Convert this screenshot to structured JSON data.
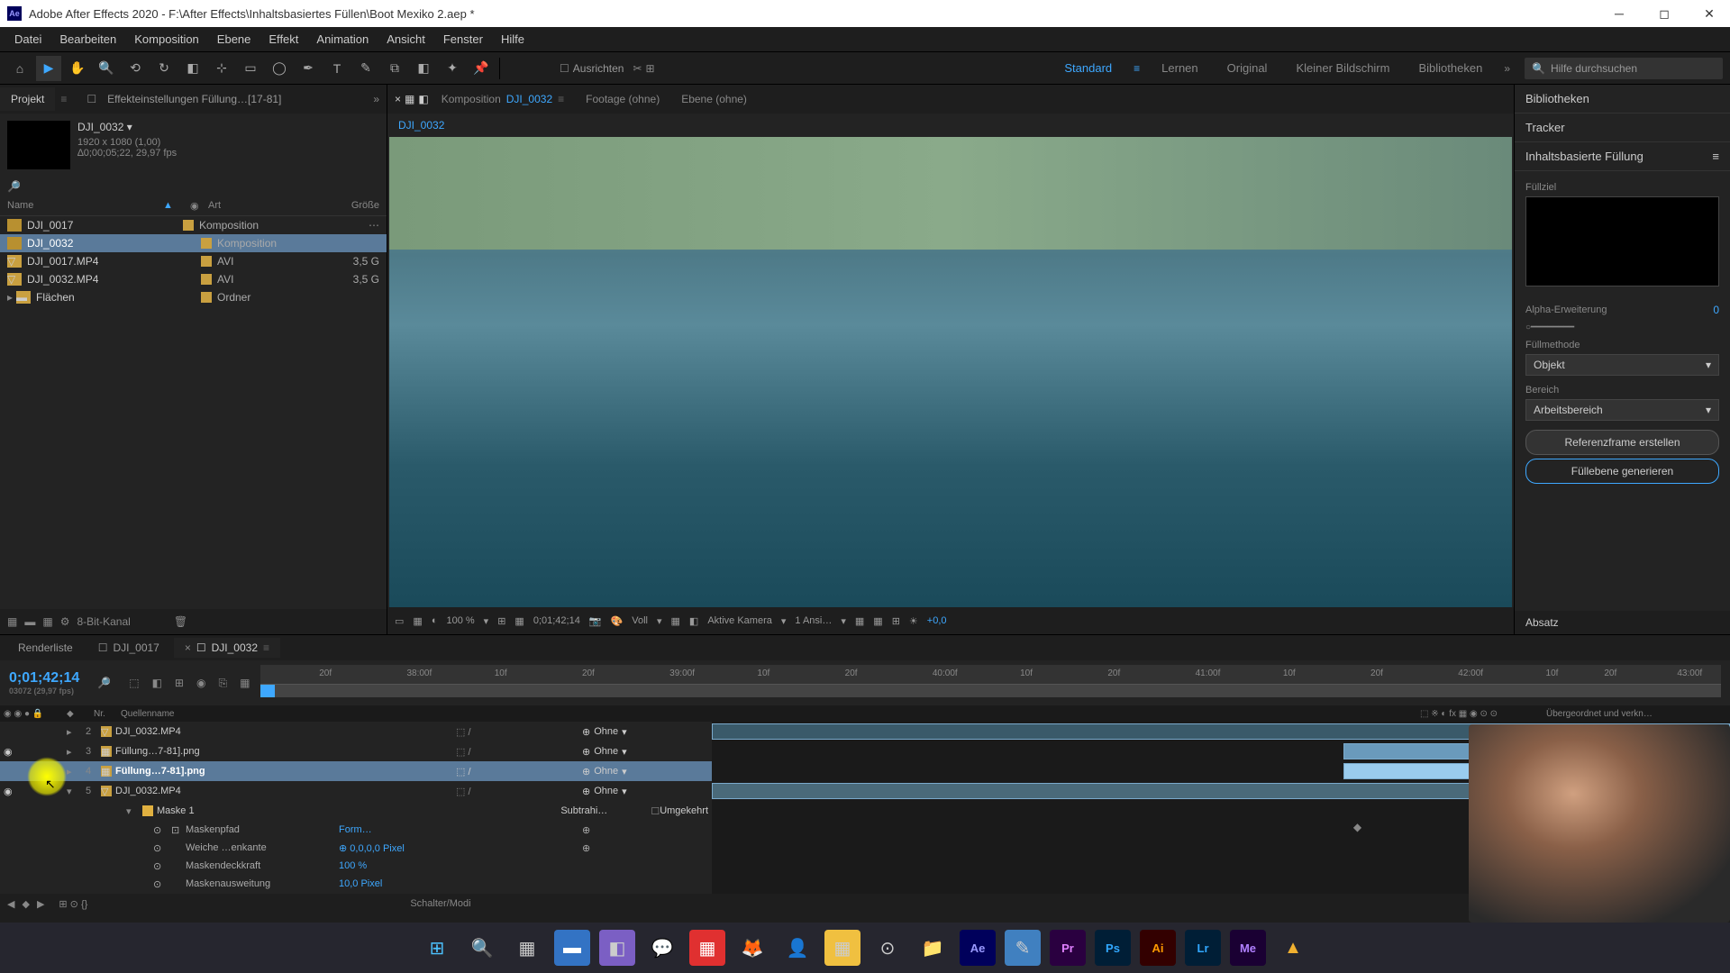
{
  "titlebar": {
    "app_icon": "Ae",
    "title": "Adobe After Effects 2020 - F:\\After Effects\\Inhaltsbasiertes Füllen\\Boot Mexiko 2.aep *"
  },
  "menubar": {
    "items": [
      "Datei",
      "Bearbeiten",
      "Komposition",
      "Ebene",
      "Effekt",
      "Animation",
      "Ansicht",
      "Fenster",
      "Hilfe"
    ]
  },
  "toolbar": {
    "ausrichten": "Ausrichten",
    "workspaces": [
      "Standard",
      "Lernen",
      "Original",
      "Kleiner Bildschirm",
      "Bibliotheken"
    ],
    "search_placeholder": "Hilfe durchsuchen"
  },
  "project": {
    "tab_project": "Projekt",
    "tab_effect": "Effekteinstellungen  Füllung…[17-81]",
    "comp_name": "DJI_0032 ▾",
    "comp_res": "1920 x 1080 (1,00)",
    "comp_dur": "∆0;00;05;22, 29,97 fps",
    "cols": {
      "name": "Name",
      "art": "Art",
      "size": "Größe"
    },
    "items": [
      {
        "name": "DJI_0017",
        "art": "Komposition",
        "size": ""
      },
      {
        "name": "DJI_0032",
        "art": "Komposition",
        "size": ""
      },
      {
        "name": "DJI_0017.MP4",
        "art": "AVI",
        "size": "3,5 G"
      },
      {
        "name": "DJI_0032.MP4",
        "art": "AVI",
        "size": "3,5 G"
      },
      {
        "name": "Flächen",
        "art": "Ordner",
        "size": ""
      }
    ],
    "footer": "8-Bit-Kanal"
  },
  "comp": {
    "tab_comp_label": "Komposition",
    "tab_comp_name": "DJI_0032",
    "tab_footage": "Footage  (ohne)",
    "tab_ebene": "Ebene  (ohne)",
    "breadcrumb": "DJI_0032",
    "controls": {
      "zoom": "100 %",
      "timecode": "0;01;42;14",
      "quality": "Voll",
      "camera": "Aktive Kamera",
      "view": "1 Ansi…",
      "exposure": "+0,0"
    }
  },
  "right": {
    "panel_bibliotheken": "Bibliotheken",
    "panel_tracker": "Tracker",
    "panel_fill": "Inhaltsbasierte Füllung",
    "fill_target_label": "Füllziel",
    "alpha_label": "Alpha-Erweiterung",
    "alpha_val": "0",
    "method_label": "Füllmethode",
    "method_val": "Objekt",
    "range_label": "Bereich",
    "range_val": "Arbeitsbereich",
    "btn_ref": "Referenzframe erstellen",
    "btn_gen": "Füllebene generieren",
    "panel_absatz": "Absatz"
  },
  "timeline": {
    "tab_render": "Renderliste",
    "tab_0017": "DJI_0017",
    "tab_0032": "DJI_0032",
    "timecode": "0;01;42;14",
    "timecode_sub": "03072 (29,97 fps)",
    "cols": {
      "nr": "Nr.",
      "source": "Quellenname",
      "parent": "Übergeordnet und verkn…"
    },
    "ruler": [
      "20f",
      "38:00f",
      "10f",
      "20f",
      "39:00f",
      "10f",
      "20f",
      "40:00f",
      "10f",
      "20f",
      "41:00f",
      "10f",
      "20f",
      "42:00f",
      "10f",
      "20f",
      "43:00f"
    ],
    "layers": [
      {
        "idx": "2",
        "name": "DJI_0032.MP4",
        "mode": "Ohne"
      },
      {
        "idx": "3",
        "name": "Füllung…7-81].png",
        "mode": "Ohne"
      },
      {
        "idx": "4",
        "name": "Füllung…7-81].png",
        "mode": "Ohne"
      },
      {
        "idx": "5",
        "name": "DJI_0032.MP4",
        "mode": "Ohne"
      }
    ],
    "mask": {
      "name": "Maske 1",
      "mode": "Subtrahi…",
      "invert": "Umgekehrt",
      "props": [
        {
          "name": "Maskenpfad",
          "val": "Form…"
        },
        {
          "name": "Weiche …enkante",
          "val": "⊕ 0,0,0,0 Pixel"
        },
        {
          "name": "Maskendeckkraft",
          "val": "100 %"
        },
        {
          "name": "Maskenausweitung",
          "val": "10,0 Pixel"
        }
      ]
    },
    "footer": "Schalter/Modi"
  }
}
